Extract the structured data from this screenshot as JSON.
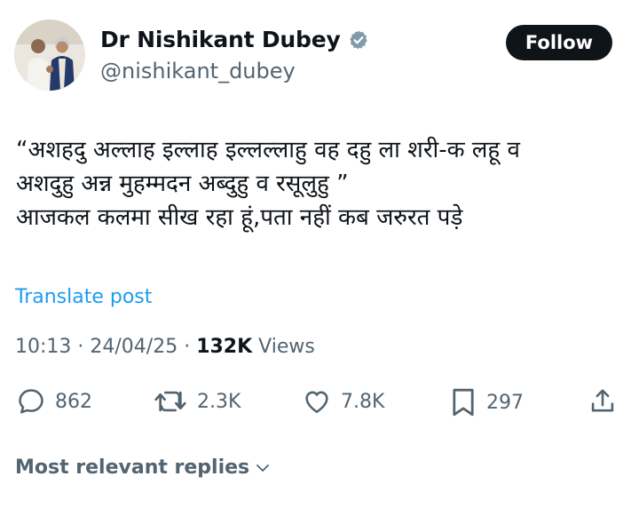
{
  "author": {
    "display_name": "Dr Nishikant Dubey",
    "handle": "@nishikant_dubey",
    "verified_badge_color": "#829aab"
  },
  "follow_button": {
    "label": "Follow"
  },
  "post": {
    "lines": [
      "“अशहदु अल्लाह इल्लाह इल्लल्लाहु वह दहु ला शरी-क लहू व",
      "अशदुहु अन्न मुहम्मदन अब्दुहु व रसूलुहु ”",
      "आजकल कलमा सीख रहा हूं,पता नहीं कब जरुरत पड़े"
    ],
    "translate_label": "Translate post"
  },
  "meta": {
    "time": "10:13",
    "separator": " · ",
    "date": "24/04/25",
    "views_count": "132K",
    "views_label": " Views"
  },
  "actions": {
    "replies": "862",
    "reposts": "2.3K",
    "likes": "7.8K",
    "bookmarks": "297"
  },
  "replies_sort": {
    "label": "Most relevant replies"
  },
  "colors": {
    "text_primary": "#0f1419",
    "text_secondary": "#536471",
    "link": "#1d9bf0"
  }
}
